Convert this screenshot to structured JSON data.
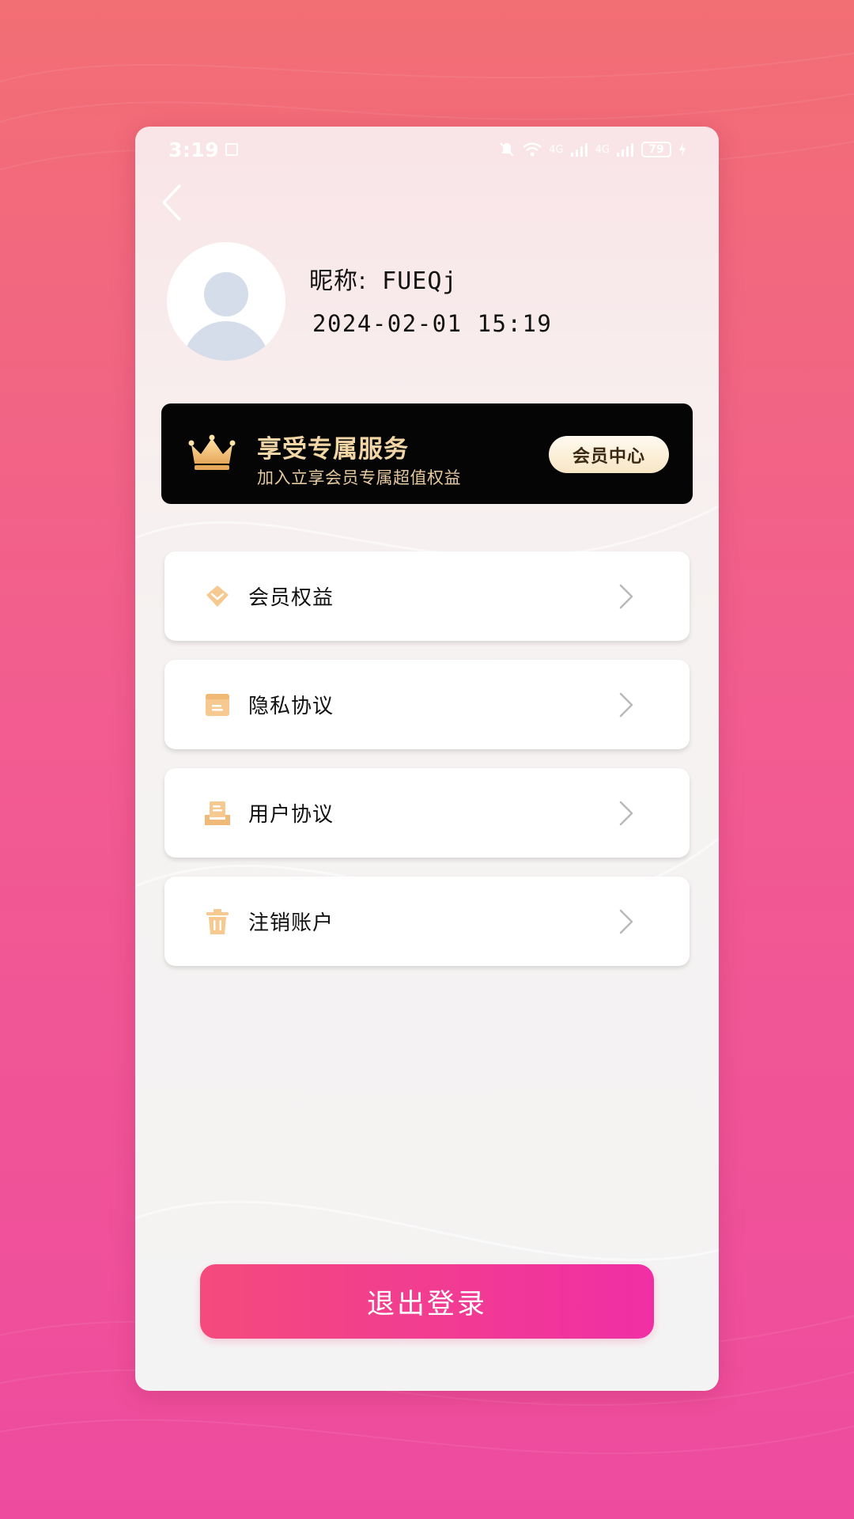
{
  "status_bar": {
    "time": "3:19",
    "network_1": "4G",
    "network_2": "4G",
    "battery": "79"
  },
  "profile": {
    "nickname_label": "昵称:",
    "nickname": "FUEQj",
    "date": "2024-02-01",
    "time": "15:19"
  },
  "vip_banner": {
    "title": "享受专属服务",
    "subtitle": "加入立享会员专属超值权益",
    "button_label": "会员中心"
  },
  "menu": {
    "items": [
      {
        "label": "会员权益",
        "icon": "diamond-icon"
      },
      {
        "label": "隐私协议",
        "icon": "privacy-doc-icon"
      },
      {
        "label": "用户协议",
        "icon": "user-agreement-icon"
      },
      {
        "label": "注销账户",
        "icon": "trash-icon"
      }
    ]
  },
  "logout": {
    "label": "退出登录"
  },
  "colors": {
    "accent_gradient_start": "#f44a7c",
    "accent_gradient_end": "#f02fa5",
    "icon_gold": "#f5c98f",
    "vip_gold": "#f3d6a6"
  }
}
